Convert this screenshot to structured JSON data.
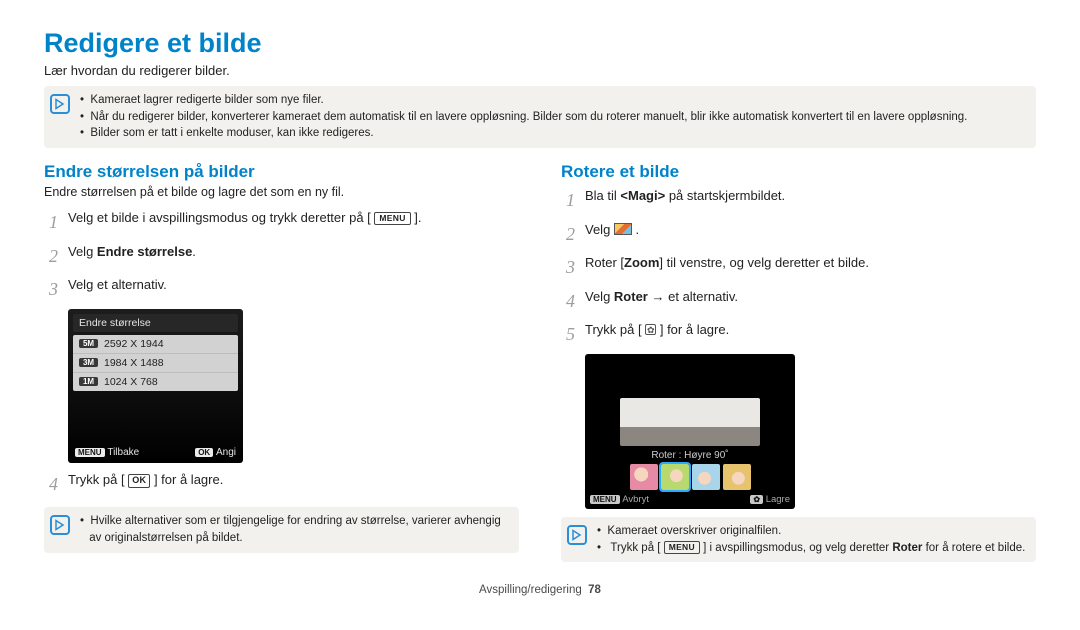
{
  "title": "Redigere et bilde",
  "subtitle": "Lær hvordan du redigerer bilder.",
  "top_notes": [
    "Kameraet lagrer redigerte bilder som nye filer.",
    "Når du redigerer bilder, konverterer kameraet dem automatisk til en lavere oppløsning. Bilder som du roterer manuelt, blir ikke automatisk konvertert til en lavere oppløsning.",
    "Bilder som er tatt i enkelte moduser, kan ikke redigeres."
  ],
  "left": {
    "heading": "Endre størrelsen på bilder",
    "sub": "Endre størrelsen på et bilde og lagre det som en ny fil.",
    "steps": {
      "s1_a": "Velg et bilde i avspillingsmodus og trykk deretter på [",
      "s1_btn": "MENU",
      "s1_b": "].",
      "s2_a": "Velg ",
      "s2_bold": "Endre størrelse",
      "s2_b": ".",
      "s3": "Velg et alternativ.",
      "s4_a": "Trykk på [",
      "s4_btn": "OK",
      "s4_b": "] for å lagre."
    },
    "menu": {
      "header": "Endre størrelse",
      "rows": [
        {
          "tag": "5M",
          "val": "2592 X 1944"
        },
        {
          "tag": "3M",
          "val": "1984 X 1488"
        },
        {
          "tag": "1M",
          "val": "1024 X 768"
        }
      ],
      "back_tag": "MENU",
      "back": "Tilbake",
      "ok_tag": "OK",
      "ok": "Angi"
    },
    "note": "Hvilke alternativer som er tilgjengelige for endring av størrelse, varierer avhengig av originalstørrelsen på bildet."
  },
  "right": {
    "heading": "Rotere et bilde",
    "steps": {
      "s1_a": "Bla til ",
      "s1_bold": "<Magi>",
      "s1_b": " på startskjermbildet.",
      "s2_a": "Velg ",
      "s2_b": ".",
      "s3_a": "Roter [",
      "s3_bold": "Zoom",
      "s3_b": "] til venstre, og velg deretter et bilde.",
      "s4_a": "Velg ",
      "s4_bold": "Roter",
      "s4_b": " → et alternativ.",
      "s5_a": "Trykk på [",
      "s5_b": "] for å lagre."
    },
    "preview": {
      "label": "Roter : Høyre 90˚",
      "cancel_tag": "MENU",
      "cancel": "Avbryt",
      "save": "Lagre"
    },
    "notes": {
      "n1": "Kameraet overskriver originalfilen.",
      "n2_a": "Trykk på [",
      "n2_btn": "MENU",
      "n2_b": "] i avspillingsmodus, og velg deretter ",
      "n2_bold": "Roter",
      "n2_c": " for å rotere et bilde."
    }
  },
  "footer": {
    "section": "Avspilling/redigering",
    "page": "78"
  }
}
